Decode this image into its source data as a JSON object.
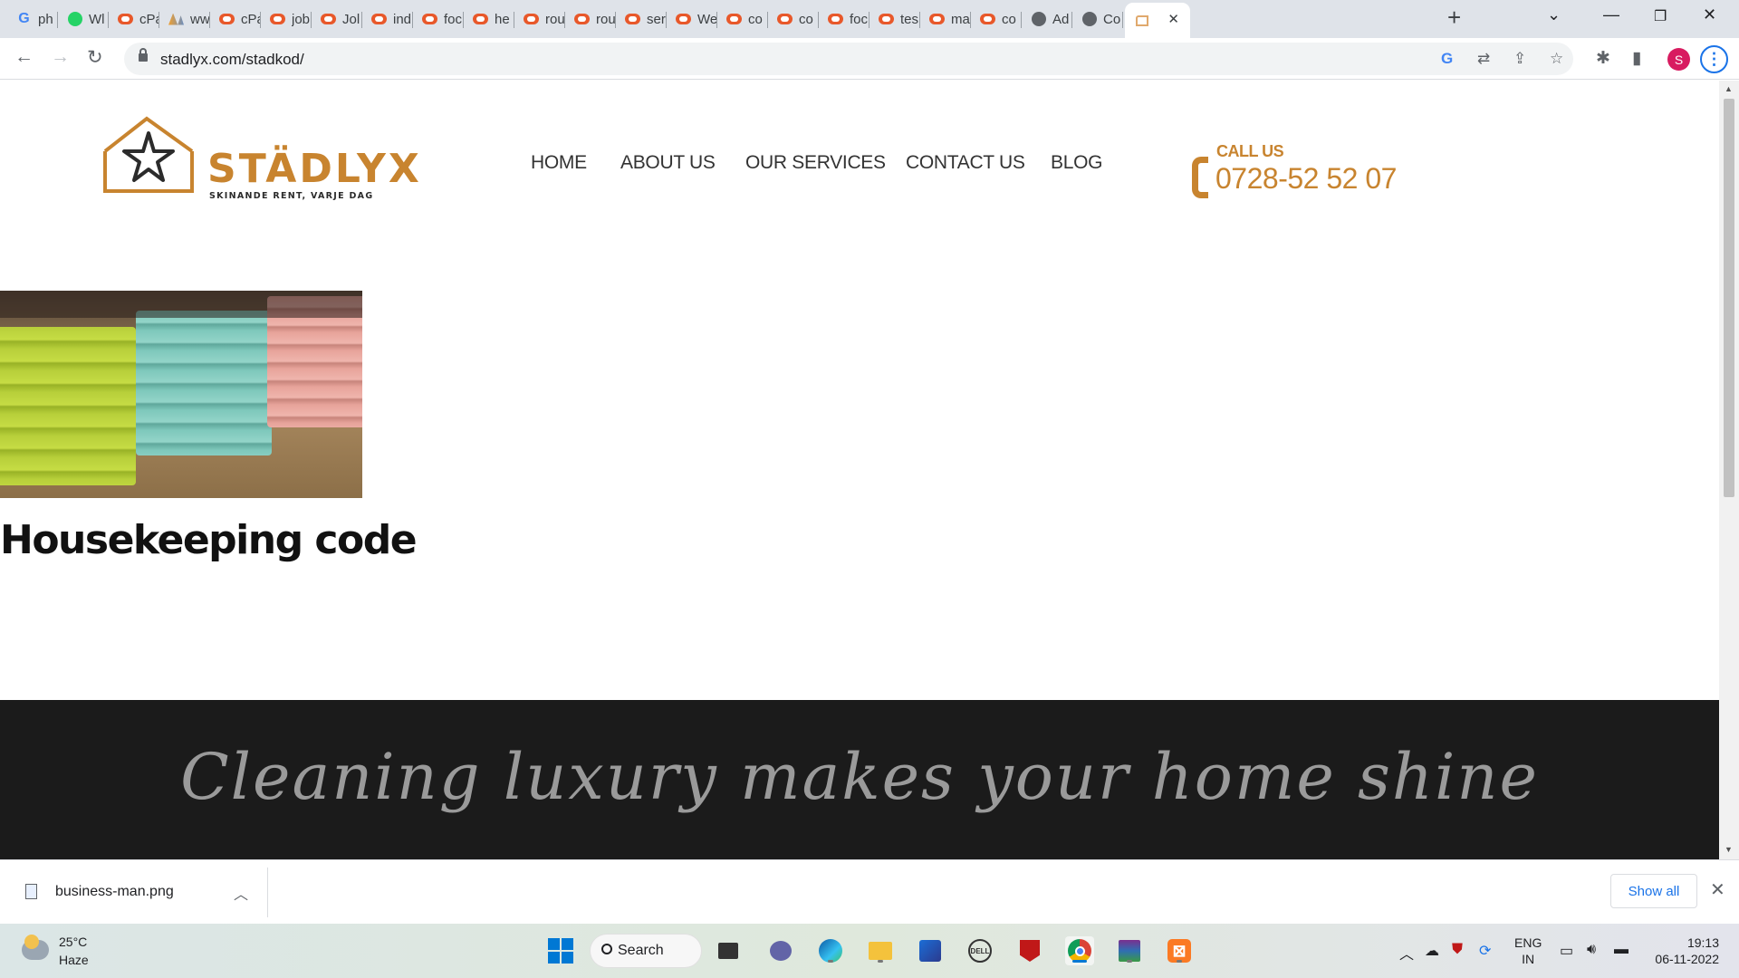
{
  "browser": {
    "tabs": [
      {
        "icon": "google-icon",
        "title": "ph"
      },
      {
        "icon": "whatsapp-icon",
        "title": "Wl"
      },
      {
        "icon": "cpanel-icon",
        "title": "cPa"
      },
      {
        "icon": "phpmyadmin-icon",
        "title": "ww"
      },
      {
        "icon": "cpanel-icon",
        "title": "cPa"
      },
      {
        "icon": "cpanel-icon",
        "title": "job"
      },
      {
        "icon": "cpanel-icon",
        "title": "Jol"
      },
      {
        "icon": "cpanel-icon",
        "title": "ind"
      },
      {
        "icon": "cpanel-icon",
        "title": "foc"
      },
      {
        "icon": "cpanel-icon",
        "title": "he"
      },
      {
        "icon": "cpanel-icon",
        "title": "rou"
      },
      {
        "icon": "cpanel-icon",
        "title": "rou"
      },
      {
        "icon": "cpanel-icon",
        "title": "ser"
      },
      {
        "icon": "cpanel-icon",
        "title": "We"
      },
      {
        "icon": "cpanel-icon",
        "title": "co"
      },
      {
        "icon": "cpanel-icon",
        "title": "co"
      },
      {
        "icon": "cpanel-icon",
        "title": "foc"
      },
      {
        "icon": "cpanel-icon",
        "title": "tes"
      },
      {
        "icon": "cpanel-icon",
        "title": "ma"
      },
      {
        "icon": "cpanel-icon",
        "title": "co"
      },
      {
        "icon": "globe-icon",
        "title": "Ad"
      },
      {
        "icon": "globe-icon",
        "title": "Co"
      },
      {
        "icon": "stadlyx-icon",
        "title": "",
        "active": true
      }
    ],
    "url": "stadlyx.com/stadkod/",
    "profile_initial": "S"
  },
  "site": {
    "logo_name": "STÄDLYX",
    "logo_tagline": "SKINANDE RENT, VARJE DAG",
    "nav": [
      "HOME",
      "ABOUT US",
      "OUR SERVICES",
      "CONTACT US",
      "BLOG"
    ],
    "call_label": "CALL US",
    "phone": "0728-52 52 07",
    "post_title": "Housekeeping code",
    "tagline": "Cleaning luxury makes your home shine"
  },
  "download_bar": {
    "file_name": "business-man.png",
    "show_all_label": "Show all"
  },
  "taskbar": {
    "temperature": "25°C",
    "condition": "Haze",
    "search_label": "Search",
    "lang_top": "ENG",
    "lang_bottom": "IN",
    "time": "19:13",
    "date": "06-11-2022"
  },
  "colors": {
    "brand_gold": "#c8842f",
    "footer_dark": "#1b1b1b",
    "chrome_blue": "#1a73e8"
  }
}
